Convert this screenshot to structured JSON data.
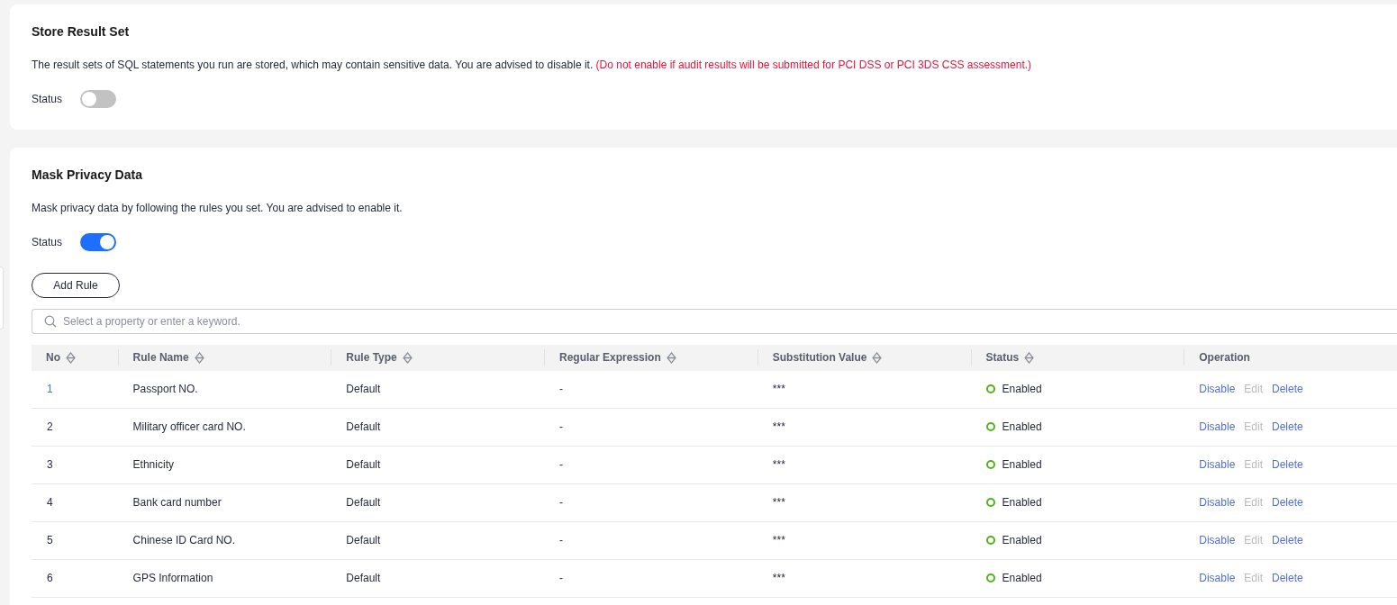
{
  "store_result_set": {
    "title": "Store Result Set",
    "description": "The result sets of SQL statements you run are stored, which may contain sensitive data. You are advised to disable it.",
    "warning": "(Do not enable if audit results will be submitted for PCI DSS or PCI 3DS CSS assessment.)",
    "status_label": "Status",
    "on": false
  },
  "mask_privacy_data": {
    "title": "Mask Privacy Data",
    "description": "Mask privacy data by following the rules you set. You are advised to enable it.",
    "status_label": "Status",
    "on": true,
    "add_button": "Add Rule",
    "search": {
      "placeholder": "Select a property or enter a keyword."
    },
    "table": {
      "columns": [
        {
          "label": "No",
          "sortable": true
        },
        {
          "label": "Rule Name",
          "sortable": true
        },
        {
          "label": "Rule Type",
          "sortable": true
        },
        {
          "label": "Regular Expression",
          "sortable": true
        },
        {
          "label": "Substitution Value",
          "sortable": true
        },
        {
          "label": "Status",
          "sortable": true
        },
        {
          "label": "Operation",
          "sortable": false
        }
      ],
      "rows": [
        {
          "no": "1",
          "no_link": true,
          "rule_name": "Passport NO.",
          "rule_type": "Default",
          "regex": "-",
          "substitution": "***",
          "status": "Enabled",
          "operations": [
            {
              "label": "Disable",
              "disabled": false
            },
            {
              "label": "Edit",
              "disabled": true
            },
            {
              "label": "Delete",
              "disabled": false
            }
          ]
        },
        {
          "no": "2",
          "no_link": false,
          "rule_name": "Military officer card NO.",
          "rule_type": "Default",
          "regex": "-",
          "substitution": "***",
          "status": "Enabled",
          "operations": [
            {
              "label": "Disable",
              "disabled": false
            },
            {
              "label": "Edit",
              "disabled": true
            },
            {
              "label": "Delete",
              "disabled": false
            }
          ]
        },
        {
          "no": "3",
          "no_link": false,
          "rule_name": "Ethnicity",
          "rule_type": "Default",
          "regex": "-",
          "substitution": "***",
          "status": "Enabled",
          "operations": [
            {
              "label": "Disable",
              "disabled": false
            },
            {
              "label": "Edit",
              "disabled": true
            },
            {
              "label": "Delete",
              "disabled": false
            }
          ]
        },
        {
          "no": "4",
          "no_link": false,
          "rule_name": "Bank card number",
          "rule_type": "Default",
          "regex": "-",
          "substitution": "***",
          "status": "Enabled",
          "operations": [
            {
              "label": "Disable",
              "disabled": false
            },
            {
              "label": "Edit",
              "disabled": true
            },
            {
              "label": "Delete",
              "disabled": false
            }
          ]
        },
        {
          "no": "5",
          "no_link": false,
          "rule_name": "Chinese ID Card NO.",
          "rule_type": "Default",
          "regex": "-",
          "substitution": "***",
          "status": "Enabled",
          "operations": [
            {
              "label": "Disable",
              "disabled": false
            },
            {
              "label": "Edit",
              "disabled": true
            },
            {
              "label": "Delete",
              "disabled": false
            }
          ]
        },
        {
          "no": "6",
          "no_link": false,
          "rule_name": "GPS Information",
          "rule_type": "Default",
          "regex": "-",
          "substitution": "***",
          "status": "Enabled",
          "operations": [
            {
              "label": "Disable",
              "disabled": false
            },
            {
              "label": "Edit",
              "disabled": true
            },
            {
              "label": "Delete",
              "disabled": false
            }
          ]
        }
      ]
    }
  }
}
